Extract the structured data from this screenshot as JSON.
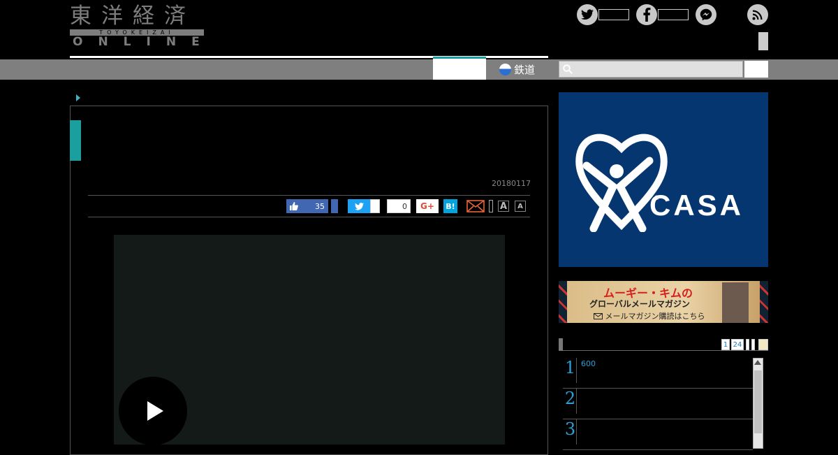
{
  "header": {
    "logo_main": "東洋経済",
    "logo_romaji": "TOYOKEIZAI",
    "logo_sub": "ONLINE",
    "sns": [
      {
        "name": "twitter",
        "glyph": "t"
      },
      {
        "name": "facebook",
        "glyph": "f"
      },
      {
        "name": "messenger",
        "glyph": "m"
      },
      {
        "name": "rss",
        "glyph": "rss"
      }
    ]
  },
  "nav": {
    "rail_label": "鉄道"
  },
  "article": {
    "date": "20180117",
    "share": {
      "like_count": "35",
      "hatebu_count": "0",
      "gplus_label": "G+",
      "hatena_label": "B!",
      "font_large": "A",
      "font_small": "A"
    }
  },
  "sidebar": {
    "ad_casa": {
      "brand": "CASA"
    },
    "ad_kim": {
      "title": "ムーギー・キムの",
      "subtitle": "グローバルメールマガジン",
      "cta": "メールマガジン購読はこちら"
    },
    "ranking": {
      "tabs": [
        "1",
        "24"
      ],
      "items": [
        {
          "rank": "1",
          "text": "600"
        },
        {
          "rank": "2",
          "text": ""
        },
        {
          "rank": "3",
          "text": ""
        }
      ]
    }
  },
  "colors": {
    "accent_teal": "#1a9e9e",
    "nav_gray": "#7f7f7f",
    "casa_blue": "#063670",
    "rank_blue": "#2a9fd6"
  }
}
